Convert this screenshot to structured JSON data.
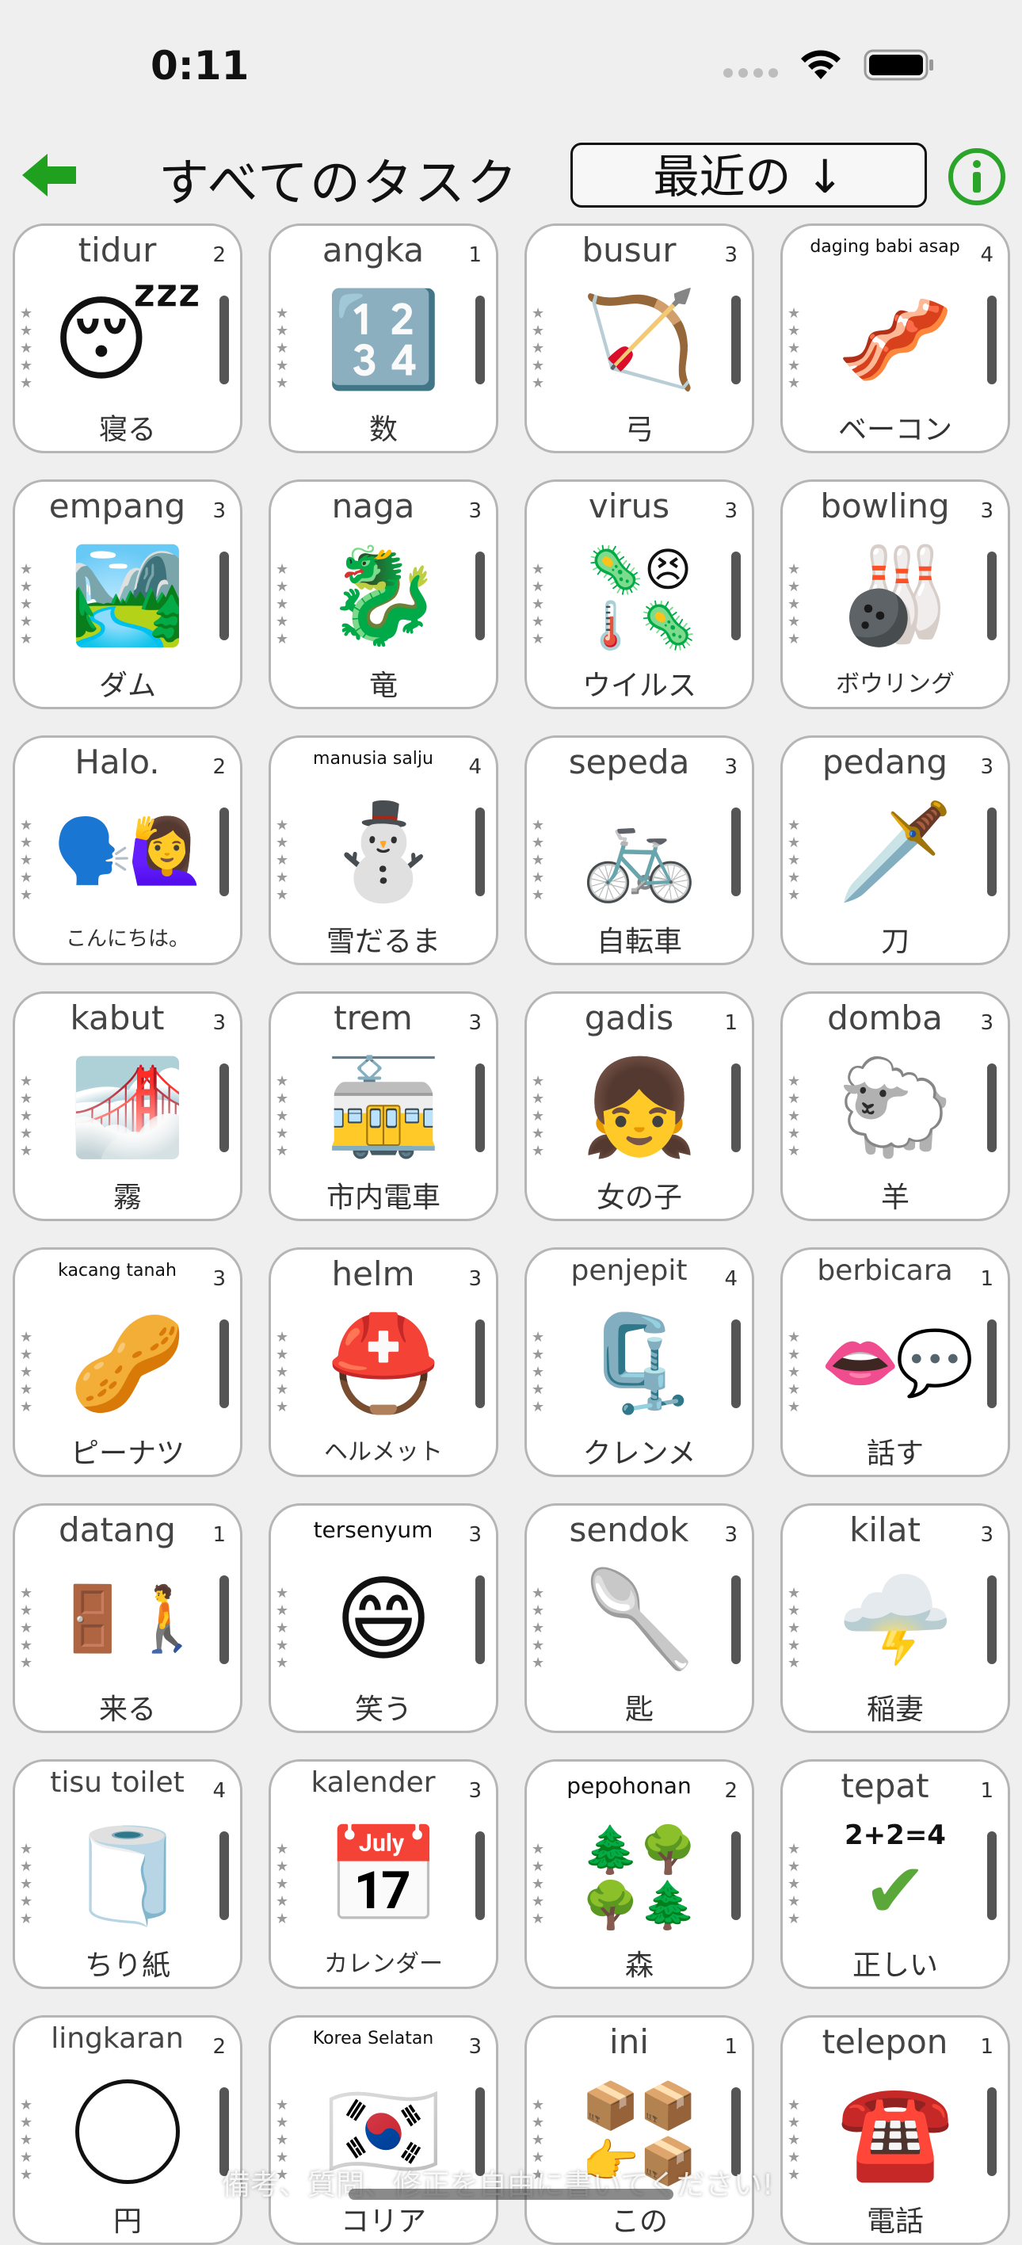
{
  "status": {
    "time": "0:11"
  },
  "nav": {
    "title": "すべてのタスク",
    "sort_label": "最近の ↓"
  },
  "cards": [
    {
      "word": "tidur",
      "count": "2",
      "emoji": "😴",
      "translation": "寝る",
      "size": "big"
    },
    {
      "word": "angka",
      "count": "1",
      "emoji": "🔢",
      "translation": "数",
      "size": "big"
    },
    {
      "word": "busur",
      "count": "3",
      "emoji": "🏹",
      "translation": "弓",
      "size": "big"
    },
    {
      "word": "daging babi asap",
      "count": "4",
      "emoji": "🥓",
      "translation": "ベーコン",
      "size": "xs"
    },
    {
      "word": "empang",
      "count": "3",
      "emoji": "🏞️",
      "translation": "ダム",
      "size": "big"
    },
    {
      "word": "naga",
      "count": "3",
      "emoji": "🐉",
      "translation": "竜",
      "size": "big"
    },
    {
      "word": "virus",
      "count": "3",
      "emoji": "🦠😣🌡️🦠",
      "translation": "ウイルス",
      "size": "big",
      "style": "grid4"
    },
    {
      "word": "bowling",
      "count": "3",
      "emoji": "🎳",
      "translation": "ボウリング",
      "size": "big",
      "tsize": "small"
    },
    {
      "word": "Halo.",
      "count": "2",
      "emoji": "🗣️🙋‍♀️",
      "translation": "こんにちは。",
      "size": "big",
      "style": "two",
      "tsize": "tiny"
    },
    {
      "word": "manusia salju",
      "count": "4",
      "emoji": "⛄",
      "translation": "雪だるま",
      "size": "xs"
    },
    {
      "word": "sepeda",
      "count": "3",
      "emoji": "🚲",
      "translation": "自転車",
      "size": "big"
    },
    {
      "word": "pedang",
      "count": "3",
      "emoji": "🗡️",
      "translation": "刀",
      "size": "big"
    },
    {
      "word": "kabut",
      "count": "3",
      "emoji": "🌁",
      "translation": "霧",
      "size": "big"
    },
    {
      "word": "trem",
      "count": "3",
      "emoji": "🚋",
      "translation": "市内電車",
      "size": "big"
    },
    {
      "word": "gadis",
      "count": "1",
      "emoji": "👧",
      "translation": "女の子",
      "size": "big"
    },
    {
      "word": "domba",
      "count": "3",
      "emoji": "🐑",
      "translation": "羊",
      "size": "big"
    },
    {
      "word": "kacang tanah",
      "count": "3",
      "emoji": "🥜",
      "translation": "ピーナツ",
      "size": "xs"
    },
    {
      "word": "helm",
      "count": "3",
      "emoji": "⛑️",
      "translation": "ヘルメット",
      "size": "big",
      "tsize": "small"
    },
    {
      "word": "penjepit",
      "count": "4",
      "emoji": "🗜️",
      "translation": "クレンメ",
      "size": "mid"
    },
    {
      "word": "berbicara",
      "count": "1",
      "emoji": "👄💬",
      "translation": "話す",
      "size": "mid",
      "style": "two"
    },
    {
      "word": "datang",
      "count": "1",
      "emoji": "🚪🚶",
      "translation": "来る",
      "size": "big",
      "style": "two"
    },
    {
      "word": "tersenyum",
      "count": "3",
      "emoji": "😄",
      "translation": "笑う",
      "size": "sm"
    },
    {
      "word": "sendok",
      "count": "3",
      "emoji": "🥄",
      "translation": "匙",
      "size": "big"
    },
    {
      "word": "kilat",
      "count": "3",
      "emoji": "🌩️",
      "translation": "稲妻",
      "size": "big"
    },
    {
      "word": "tisu toilet",
      "count": "4",
      "emoji": "🧻",
      "translation": "ちり紙",
      "size": "mid"
    },
    {
      "word": "kalender",
      "count": "3",
      "emoji": "📅",
      "translation": "カレンダー",
      "size": "mid",
      "tsize": "small"
    },
    {
      "word": "pepohonan",
      "count": "2",
      "emoji": "🌲🌳🌳🌲",
      "translation": "森",
      "size": "sm",
      "style": "grid4"
    },
    {
      "word": "tepat",
      "count": "1",
      "emoji": "2+2=4",
      "translation": "正しい",
      "size": "big",
      "style": "math"
    },
    {
      "word": "lingkaran",
      "count": "2",
      "emoji": "",
      "translation": "円",
      "size": "mid",
      "style": "circle"
    },
    {
      "word": "Korea Selatan",
      "count": "3",
      "emoji": "🇰🇷",
      "translation": "コリア",
      "size": "xs"
    },
    {
      "word": "ini",
      "count": "1",
      "emoji": "📦📦👉📦",
      "translation": "この",
      "size": "big",
      "style": "grid4"
    },
    {
      "word": "telepon",
      "count": "1",
      "emoji": "☎️",
      "translation": "電話",
      "size": "big"
    }
  ],
  "overlay_text": "備考、質問、修正を自由に書いてください!"
}
